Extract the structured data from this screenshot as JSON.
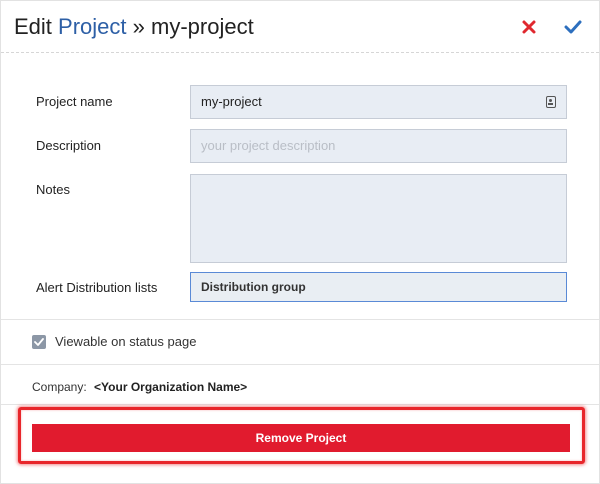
{
  "header": {
    "title_prefix": "Edit",
    "title_link": "Project",
    "title_sep": "»",
    "title_project": "my-project",
    "cancel_icon": "close-x-icon",
    "confirm_icon": "checkmark-icon",
    "cancel_color": "#e0282f",
    "confirm_color": "#2d6fbe"
  },
  "form": {
    "project_name": {
      "label": "Project name",
      "value": "my-project",
      "icon": "id-badge-icon"
    },
    "description": {
      "label": "Description",
      "value": "",
      "placeholder": "your project description"
    },
    "notes": {
      "label": "Notes",
      "value": ""
    },
    "alert_lists": {
      "label": "Alert Distribution lists",
      "value": "Distribution group"
    }
  },
  "viewable": {
    "label": "Viewable on status page",
    "checked": true
  },
  "company": {
    "label": "Company:",
    "value": "<Your Organization Name>"
  },
  "actions": {
    "remove_label": "Remove Project",
    "remove_color": "#e11b2e"
  }
}
